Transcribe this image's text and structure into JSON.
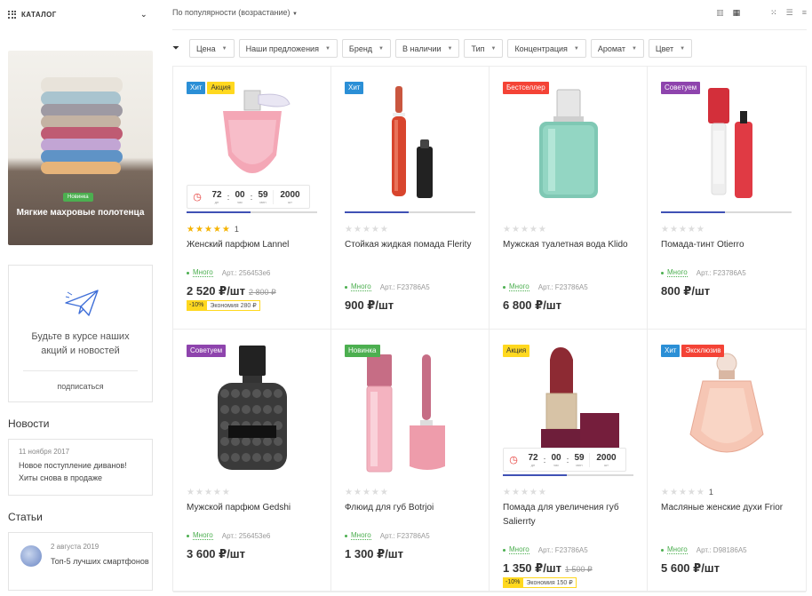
{
  "sidebar": {
    "catalog_label": "КАТАЛОГ",
    "banner": {
      "tag": "Новинка",
      "title": "Мягкие махровые полотенца"
    },
    "subscribe": {
      "text": "Будьте в курсе наших акций и новостей",
      "link": "подписаться"
    },
    "news_title": "Новости",
    "news": {
      "date": "11 ноября 2017",
      "text": "Новое поступление диванов! Хиты снова в продаже"
    },
    "articles_title": "Статьи",
    "article": {
      "date": "2 августа 2019",
      "text": "Топ-5 лучших смартфонов"
    }
  },
  "toolbar": {
    "sort_label": "По популярности (возрастание)",
    "filters": [
      "Цена",
      "Наши предложения",
      "Бренд",
      "В наличии",
      "Тип",
      "Концентрация",
      "Аромат",
      "Цвет"
    ]
  },
  "colors": {
    "hit": "#2b8fd6",
    "sale": "#ffd81f",
    "best": "#f44336",
    "advice": "#8e44ad",
    "new": "#4caf50",
    "exclusive": "#f44336"
  },
  "products": [
    {
      "badges": [
        {
          "t": "Хит",
          "c": "hit"
        },
        {
          "t": "Акция",
          "c": "sale"
        }
      ],
      "timer": {
        "d": "72",
        "h": "00",
        "m": "59",
        "q": "2000",
        "dl": "дн",
        "hl": "час",
        "ml": "мин",
        "ql": "шт"
      },
      "stars": 5,
      "reviews": "1",
      "name": "Женский парфюм Lannel",
      "stock": "Много",
      "art": "Арт.: 256453e6",
      "price": "2 520 ₽/шт",
      "old": "2 800 ₽",
      "save_pct": "-10%",
      "save_amt": "Экономия 280 ₽",
      "image": "perfume-pink"
    },
    {
      "badges": [
        {
          "t": "Хит",
          "c": "hit"
        }
      ],
      "stars": 0,
      "name": "Стойкая жидкая помада Flerity",
      "stock": "Много",
      "art": "Арт.: F23786A5",
      "price": "900 ₽/шт",
      "image": "lip-gloss-red",
      "slider": true
    },
    {
      "badges": [
        {
          "t": "Бестселлер",
          "c": "best"
        }
      ],
      "stars": 0,
      "name": "Мужская туалетная вода Klido",
      "stock": "Много",
      "art": "Арт.: F23786A5",
      "price": "6 800 ₽/шт",
      "image": "perfume-mint"
    },
    {
      "badges": [
        {
          "t": "Советуем",
          "c": "advice"
        }
      ],
      "stars": 0,
      "name": "Помада-тинт Otierro",
      "stock": "Много",
      "art": "Арт.: F23786A5",
      "price": "800 ₽/шт",
      "image": "tint-red",
      "slider": true
    },
    {
      "badges": [
        {
          "t": "Советуем",
          "c": "advice"
        }
      ],
      "stars": 0,
      "name": "Мужской парфюм Gedshi",
      "stock": "Много",
      "art": "Арт.: 256453e6",
      "price": "3 600 ₽/шт",
      "image": "perfume-black"
    },
    {
      "badges": [
        {
          "t": "Новинка",
          "c": "new"
        }
      ],
      "stars": 0,
      "name": "Флюид для губ Botrjoi",
      "stock": "Много",
      "art": "Арт.: F23786A5",
      "price": "1 300 ₽/шт",
      "image": "fluid-pink"
    },
    {
      "badges": [
        {
          "t": "Акция",
          "c": "sale"
        }
      ],
      "timer": {
        "d": "72",
        "h": "00",
        "m": "59",
        "q": "2000",
        "dl": "дн",
        "hl": "час",
        "ml": "мин",
        "ql": "шт"
      },
      "stars": 0,
      "name": "Помада для увеличения губ Salierrty",
      "stock": "Много",
      "art": "Арт.: F23786A5",
      "price": "1 350 ₽/шт",
      "old": "1 500 ₽",
      "save_pct": "-10%",
      "save_amt": "Экономия 150 ₽",
      "image": "lipstick-red",
      "slider": true
    },
    {
      "badges": [
        {
          "t": "Хит",
          "c": "hit"
        },
        {
          "t": "Эксклюзив",
          "c": "exclusive"
        }
      ],
      "stars": 0,
      "reviews": "1",
      "name": "Масляные женские духи Frior",
      "stock": "Много",
      "art": "Арт.: D98186A5",
      "price": "5 600 ₽/шт",
      "image": "perfume-peach"
    }
  ]
}
